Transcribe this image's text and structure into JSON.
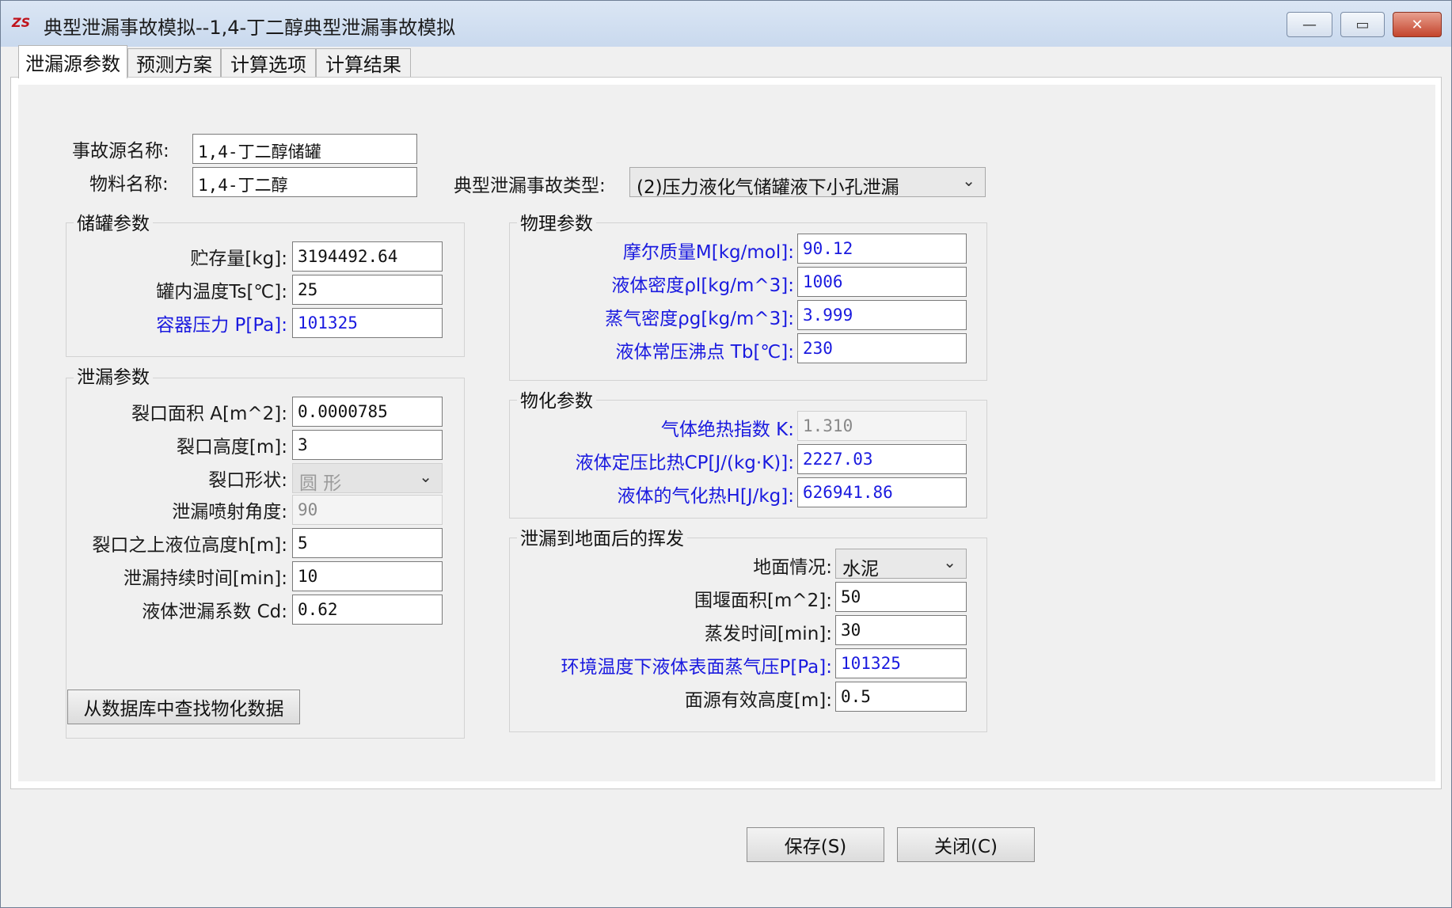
{
  "window": {
    "title": "典型泄漏事故模拟--1,4-丁二醇典型泄漏事故模拟",
    "minimize_glyph": "—",
    "maximize_glyph": "▭",
    "close_glyph": "✕",
    "icon": "app-logo-icon"
  },
  "tabs": [
    {
      "label": "泄漏源参数",
      "active": true
    },
    {
      "label": "预测方案",
      "active": false
    },
    {
      "label": "计算选项",
      "active": false
    },
    {
      "label": "计算结果",
      "active": false
    }
  ],
  "source": {
    "name_label": "事故源名称:",
    "name_value": "1,4-丁二醇储罐",
    "material_label": "物料名称:",
    "material_value": "1,4-丁二醇",
    "accident_type_label": "典型泄漏事故类型:",
    "accident_type_value": "(2)压力液化气储罐液下小孔泄漏"
  },
  "tank": {
    "title": "储罐参数",
    "fields": [
      {
        "label": "贮存量[kg]:",
        "value": "3194492.64"
      },
      {
        "label": "罐内温度Ts[℃]:",
        "value": "25"
      },
      {
        "label": "容器压力 P[Pa]:",
        "value": "101325"
      }
    ]
  },
  "leak": {
    "title": "泄漏参数",
    "area_label": "裂口面积 A[m^2]:",
    "area_value": "0.0000785",
    "height_label": "裂口高度[m]:",
    "height_value": "3",
    "shape_label": "裂口形状:",
    "shape_value": "圆  形",
    "angle_label": "泄漏喷射角度:",
    "angle_value": "90",
    "level_label": "裂口之上液位高度h[m]:",
    "level_value": "5",
    "duration_label": "泄漏持续时间[min]:",
    "duration_value": "10",
    "coef_label": "液体泄漏系数  Cd:",
    "coef_value": "0.62"
  },
  "physical": {
    "title": "物理参数",
    "fields": [
      {
        "label": "摩尔质量M[kg/mol]:",
        "value": "90.12"
      },
      {
        "label": "液体密度ρl[kg/m^3]:",
        "value": "1006"
      },
      {
        "label": "蒸气密度ρg[kg/m^3]:",
        "value": "3.999"
      },
      {
        "label": "液体常压沸点 Tb[℃]:",
        "value": "230"
      }
    ]
  },
  "chemical": {
    "title": "物化参数",
    "k_label": "气体绝热指数  K:",
    "k_value": "1.310",
    "cp_label": "液体定压比热CP[J/(kg·K)]:",
    "cp_value": "2227.03",
    "h_label": "液体的气化热H[J/kg]:",
    "h_value": "626941.86"
  },
  "evaporation": {
    "title": "泄漏到地面后的挥发",
    "ground_label": "地面情况:",
    "ground_value": "水泥",
    "bund_label": "围堰面积[m^2]:",
    "bund_value": "50",
    "time_label": "蒸发时间[min]:",
    "time_value": "30",
    "vapor_label": "环境温度下液体表面蒸气压P[Pa]:",
    "vapor_value": "101325",
    "srcheight_label": "面源有效高度[m]:",
    "srcheight_value": "0.5"
  },
  "buttons": {
    "lookup": "从数据库中查找物化数据",
    "save": "保存(S)",
    "close": "关闭(C)"
  },
  "colors": {
    "blue_label": "#1a1adf",
    "title_bar": "#c9d9ee",
    "close_button": "#c4442c"
  }
}
